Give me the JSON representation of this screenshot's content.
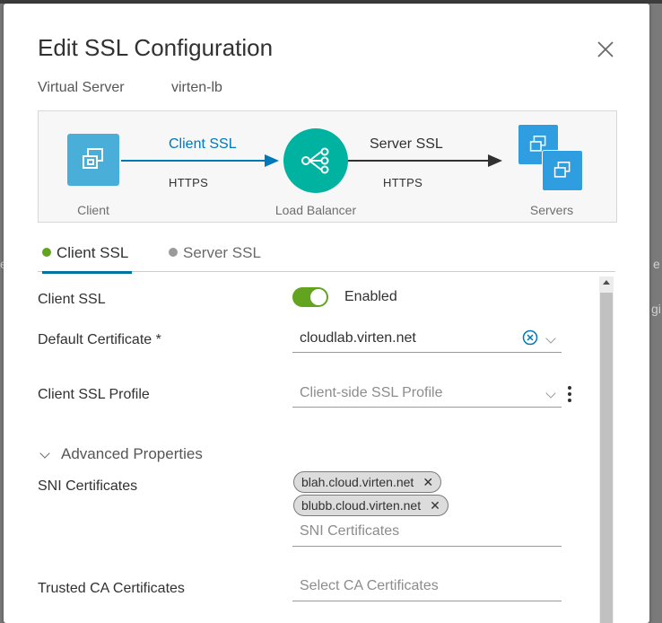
{
  "background": {
    "edge_texts": [
      "e",
      "e",
      "gi"
    ]
  },
  "dialog": {
    "title": "Edit SSL Configuration",
    "close_icon": "close-icon",
    "virtual_server_label": "Virtual Server",
    "virtual_server_value": "virten-lb"
  },
  "diagram": {
    "client_label": "Client",
    "load_balancer_label": "Load Balancer",
    "servers_label": "Servers",
    "client_ssl_label": "Client SSL",
    "client_protocol": "HTTPS",
    "server_ssl_label": "Server SSL",
    "server_protocol": "HTTPS",
    "colors": {
      "client_box": "#49afd9",
      "load_balancer": "#00b3a1",
      "client_arrow": "#0079b8",
      "server_arrow": "#313131"
    }
  },
  "tabs": [
    {
      "label": "Client SSL",
      "dot_color": "#62a420",
      "active": true
    },
    {
      "label": "Server SSL",
      "dot_color": "#9a9a9a",
      "active": false
    }
  ],
  "form": {
    "client_ssl_label": "Client SSL",
    "client_ssl_toggle_text": "Enabled",
    "client_ssl_enabled": true,
    "default_cert_label": "Default Certificate *",
    "default_cert_value": "cloudlab.virten.net",
    "client_ssl_profile_label": "Client SSL Profile",
    "client_ssl_profile_placeholder": "Client-side SSL Profile",
    "advanced_properties_label": "Advanced Properties",
    "sni_label": "SNI Certificates",
    "sni_chips": [
      "blah.cloud.virten.net",
      "blubb.cloud.virten.net"
    ],
    "sni_placeholder": "SNI Certificates",
    "trusted_ca_label": "Trusted CA Certificates",
    "trusted_ca_placeholder": "Select CA Certificates"
  }
}
